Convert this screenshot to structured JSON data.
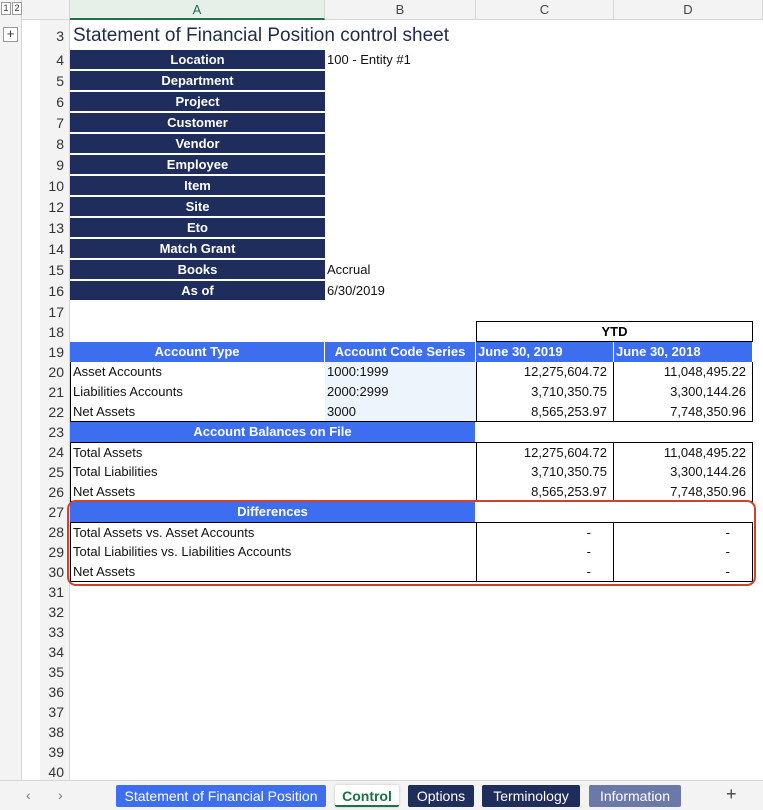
{
  "outline": {
    "level1": "1",
    "level2": "2",
    "expand": "+"
  },
  "columns": [
    "A",
    "B",
    "C",
    "D"
  ],
  "rows": {
    "r3": "3",
    "r4": "4",
    "r5": "5",
    "r6": "6",
    "r7": "7",
    "r8": "8",
    "r9": "9",
    "r10": "10",
    "r12": "12",
    "r13": "13",
    "r14": "14",
    "r15": "15",
    "r16": "16",
    "r17": "17",
    "r18": "18",
    "r19": "19",
    "r20": "20",
    "r21": "21",
    "r22": "22",
    "r23": "23",
    "r24": "24",
    "r25": "25",
    "r26": "26",
    "r27": "27",
    "r28": "28",
    "r29": "29",
    "r30": "30",
    "r31": "31",
    "r32": "32",
    "r33": "33",
    "r34": "34",
    "r35": "35",
    "r36": "36",
    "r37": "37",
    "r38": "38",
    "r39": "39",
    "r40": "40"
  },
  "sheet_title": "Statement of Financial Position control sheet",
  "filters": [
    {
      "label": "Location",
      "value": "100 - Entity #1"
    },
    {
      "label": "Department",
      "value": ""
    },
    {
      "label": "Project",
      "value": ""
    },
    {
      "label": "Customer",
      "value": ""
    },
    {
      "label": "Vendor",
      "value": ""
    },
    {
      "label": "Employee",
      "value": ""
    },
    {
      "label": "Item",
      "value": ""
    },
    {
      "label": "Site",
      "value": ""
    },
    {
      "label": "Eto",
      "value": ""
    },
    {
      "label": "Match Grant",
      "value": ""
    },
    {
      "label": "Books",
      "value": "Accrual"
    },
    {
      "label": "As of",
      "value": "6/30/2019"
    }
  ],
  "ytd_label": "YTD",
  "table_headers": {
    "account_type": "Account Type",
    "account_code_series": "Account Code Series",
    "col_c": "June 30, 2019",
    "col_d": "June 30, 2018"
  },
  "accounts": [
    {
      "type": "Asset Accounts",
      "code": "1000:1999",
      "c": "12,275,604.72",
      "d": "11,048,495.22"
    },
    {
      "type": "Liabilities Accounts",
      "code": "2000:2999",
      "c": "3,710,350.75",
      "d": "3,300,144.26"
    },
    {
      "type": "Net Assets",
      "code": "3000",
      "c": "8,565,253.97",
      "d": "7,748,350.96"
    }
  ],
  "balances_header": "Account Balances on File",
  "balances": [
    {
      "label": "Total Assets",
      "c": "12,275,604.72",
      "d": "11,048,495.22"
    },
    {
      "label": "Total Liabilities",
      "c": "3,710,350.75",
      "d": "3,300,144.26"
    },
    {
      "label": "Net Assets",
      "c": "8,565,253.97",
      "d": "7,748,350.96"
    }
  ],
  "differences_header": "Differences",
  "differences": [
    {
      "label": "Total Assets vs. Asset Accounts",
      "c": "-",
      "d": "-"
    },
    {
      "label": "Total Liabilities vs. Liabilities Accounts",
      "c": "-",
      "d": "-"
    },
    {
      "label": "Net Assets",
      "c": "-",
      "d": "-"
    }
  ],
  "tabbar": {
    "prev": "‹",
    "next": "›",
    "tabs": [
      {
        "label": "Statement of Financial Position"
      },
      {
        "label": "Control"
      },
      {
        "label": "Options"
      },
      {
        "label": "Terminology"
      },
      {
        "label": "Information"
      }
    ],
    "add": "+"
  },
  "colors": {
    "navy": "#1f2d5c",
    "blue": "#3d6ef0",
    "highlight_box": "#d2402f",
    "active_tab_underline": "#1e7145"
  }
}
